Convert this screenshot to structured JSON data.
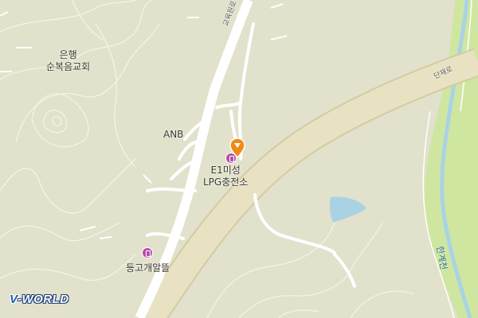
{
  "map": {
    "colors": {
      "land": "#e2e1cb",
      "contour": "#ffffff",
      "road": "#ffffff",
      "highway": "#e9e2c2",
      "water": "#a9d3e4",
      "stream_green": "#cfe6a1",
      "poi": "#b34fa8",
      "marker": "#f08a17"
    },
    "labels": {
      "church": [
        "은행",
        "순복음교회"
      ],
      "anb": "ANB",
      "station": [
        "E1미성",
        "LPG충전소"
      ],
      "place": "등고개알뜰"
    },
    "roads": {
      "gyoyuk": "교육원로",
      "danjae": "단재로"
    },
    "stream": "한계천",
    "logo": {
      "v": "V",
      "rest": "-WORLD"
    },
    "icons": {
      "station_icon": "fuel-station-icon",
      "place_icon": "fuel-station-icon",
      "marker": "location-pin-icon"
    }
  }
}
